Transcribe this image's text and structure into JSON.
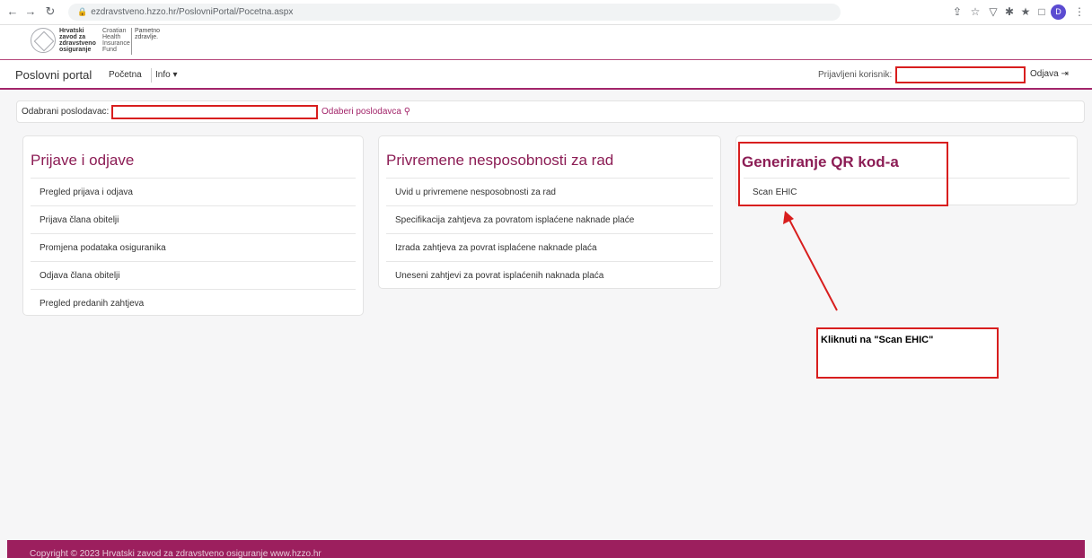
{
  "browser": {
    "url": "ezdravstveno.hzzo.hr/PoslovniPortal/Pocetna.aspx",
    "profile_initial": "D"
  },
  "logo": {
    "hr_lines": "Hrvatski zavod za zdravstveno osiguranje",
    "en_lines": "Croatian Health Insurance Fund",
    "slogan": "Pametno zdravlje."
  },
  "navbar": {
    "brand": "Poslovni portal",
    "home": "Početna",
    "info": "Info ▾",
    "user_label": "Prijavljeni korisnik:",
    "logout": "Odjava"
  },
  "employer": {
    "label": "Odabrani poslodavac:",
    "select_link": "Odaberi poslodavca"
  },
  "cards": [
    {
      "title": "Prijave i odjave",
      "items": [
        "Pregled prijava i odjava",
        "Prijava člana obitelji",
        "Promjena podataka osiguranika",
        "Odjava člana obitelji",
        "Pregled predanih zahtjeva"
      ]
    },
    {
      "title": "Privremene nesposobnosti za rad",
      "items": [
        "Uvid u privremene nesposobnosti za rad",
        "Specifikacija zahtjeva za povratom isplaćene naknade plaće",
        "Izrada zahtjeva za povrat isplaćene naknade plaća",
        "Uneseni zahtjevi za povrat isplaćenih naknada plaća"
      ]
    },
    {
      "title": "Generiranje QR kod-a",
      "items": [
        "Scan EHIC"
      ]
    }
  ],
  "annotation": "Kliknuti na \"Scan EHIC\"",
  "footer": "Copyright © 2023 Hrvatski zavod za zdravstveno osiguranje www.hzzo.hr",
  "colors": {
    "accent": "#8c1d55",
    "footer": "#9c1f5e",
    "highlight": "#d81e1e"
  },
  "icons": [
    "back-icon",
    "forward-icon",
    "reload-icon",
    "lock-icon",
    "share-icon",
    "star-icon",
    "extension-icon",
    "puzzle-icon",
    "sidepanel-icon",
    "menu-icon",
    "search-icon",
    "logout-icon"
  ]
}
